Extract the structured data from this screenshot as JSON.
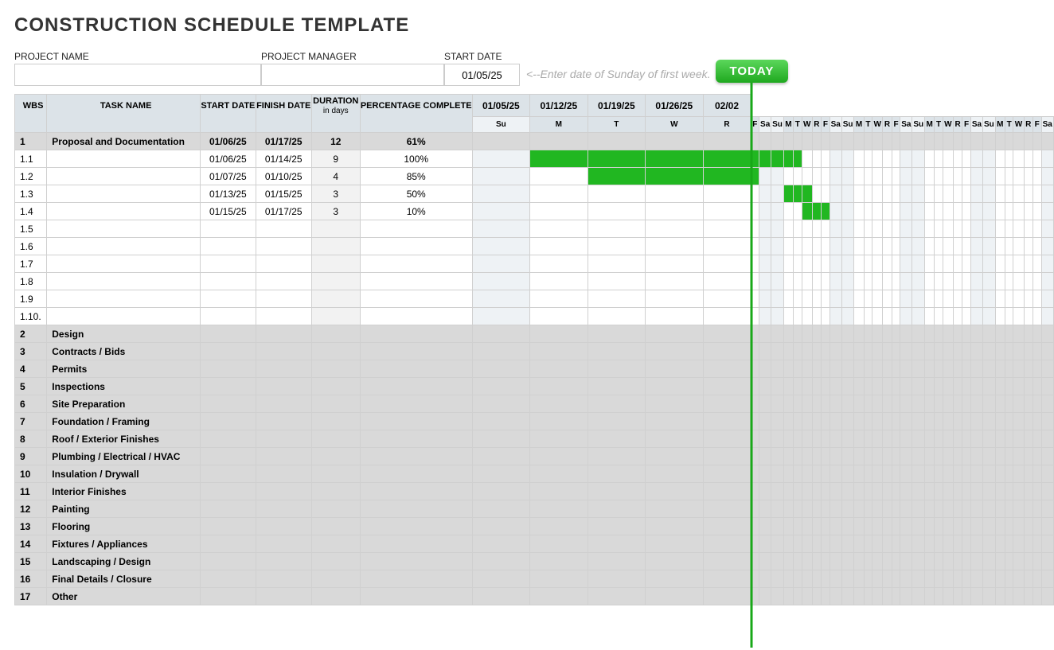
{
  "title": "CONSTRUCTION SCHEDULE TEMPLATE",
  "meta": {
    "project_name_label": "PROJECT NAME",
    "project_manager_label": "PROJECT MANAGER",
    "start_date_label": "START DATE",
    "project_name": "",
    "project_manager": "",
    "start_date": "01/05/25",
    "hint": "<--Enter date of Sunday of first week.",
    "today_label": "TODAY"
  },
  "columns": {
    "wbs": "WBS",
    "task": "TASK NAME",
    "start": "START DATE",
    "finish": "FINISH DATE",
    "duration": "DURATION",
    "duration_sub": "in days",
    "pct": "PERCENTAGE COMPLETE"
  },
  "weeks": [
    "01/05/25",
    "01/12/25",
    "01/19/25",
    "01/26/25",
    "02/02"
  ],
  "day_labels": [
    "Su",
    "M",
    "T",
    "W",
    "R",
    "F",
    "Sa"
  ],
  "today_index": 14,
  "rows": [
    {
      "type": "phase",
      "wbs": "1",
      "task": "Proposal and Documentation",
      "start": "01/06/25",
      "finish": "01/17/25",
      "dur": "12",
      "pct": "61%"
    },
    {
      "type": "task",
      "wbs": "1.1",
      "task": "",
      "start": "01/06/25",
      "finish": "01/14/25",
      "dur": "9",
      "pct": "100%",
      "bar_start": 1,
      "bar_end": 9
    },
    {
      "type": "task",
      "wbs": "1.2",
      "task": "",
      "start": "01/07/25",
      "finish": "01/10/25",
      "dur": "4",
      "pct": "85%",
      "bar_start": 2,
      "bar_end": 5
    },
    {
      "type": "task",
      "wbs": "1.3",
      "task": "",
      "start": "01/13/25",
      "finish": "01/15/25",
      "dur": "3",
      "pct": "50%",
      "bar_start": 8,
      "bar_end": 10
    },
    {
      "type": "task",
      "wbs": "1.4",
      "task": "",
      "start": "01/15/25",
      "finish": "01/17/25",
      "dur": "3",
      "pct": "10%",
      "bar_start": 10,
      "bar_end": 12
    },
    {
      "type": "task",
      "wbs": "1.5",
      "task": "",
      "start": "",
      "finish": "",
      "dur": "",
      "pct": ""
    },
    {
      "type": "task",
      "wbs": "1.6",
      "task": "",
      "start": "",
      "finish": "",
      "dur": "",
      "pct": ""
    },
    {
      "type": "task",
      "wbs": "1.7",
      "task": "",
      "start": "",
      "finish": "",
      "dur": "",
      "pct": ""
    },
    {
      "type": "task",
      "wbs": "1.8",
      "task": "",
      "start": "",
      "finish": "",
      "dur": "",
      "pct": ""
    },
    {
      "type": "task",
      "wbs": "1.9",
      "task": "",
      "start": "",
      "finish": "",
      "dur": "",
      "pct": ""
    },
    {
      "type": "task",
      "wbs": "1.10.",
      "task": "",
      "start": "",
      "finish": "",
      "dur": "",
      "pct": ""
    },
    {
      "type": "phase",
      "wbs": "2",
      "task": "Design"
    },
    {
      "type": "phase",
      "wbs": "3",
      "task": "Contracts / Bids"
    },
    {
      "type": "phase",
      "wbs": "4",
      "task": "Permits"
    },
    {
      "type": "phase",
      "wbs": "5",
      "task": "Inspections"
    },
    {
      "type": "phase",
      "wbs": "6",
      "task": "Site Preparation"
    },
    {
      "type": "phase",
      "wbs": "7",
      "task": "Foundation / Framing"
    },
    {
      "type": "phase",
      "wbs": "8",
      "task": "Roof / Exterior Finishes"
    },
    {
      "type": "phase",
      "wbs": "9",
      "task": "Plumbing / Electrical / HVAC"
    },
    {
      "type": "phase",
      "wbs": "10",
      "task": "Insulation / Drywall"
    },
    {
      "type": "phase",
      "wbs": "11",
      "task": "Interior Finishes"
    },
    {
      "type": "phase",
      "wbs": "12",
      "task": "Painting"
    },
    {
      "type": "phase",
      "wbs": "13",
      "task": "Flooring"
    },
    {
      "type": "phase",
      "wbs": "14",
      "task": "Fixtures / Appliances"
    },
    {
      "type": "phase",
      "wbs": "15",
      "task": "Landscaping / Design"
    },
    {
      "type": "phase",
      "wbs": "16",
      "task": "Final Details / Closure"
    },
    {
      "type": "phase",
      "wbs": "17",
      "task": "Other"
    }
  ]
}
